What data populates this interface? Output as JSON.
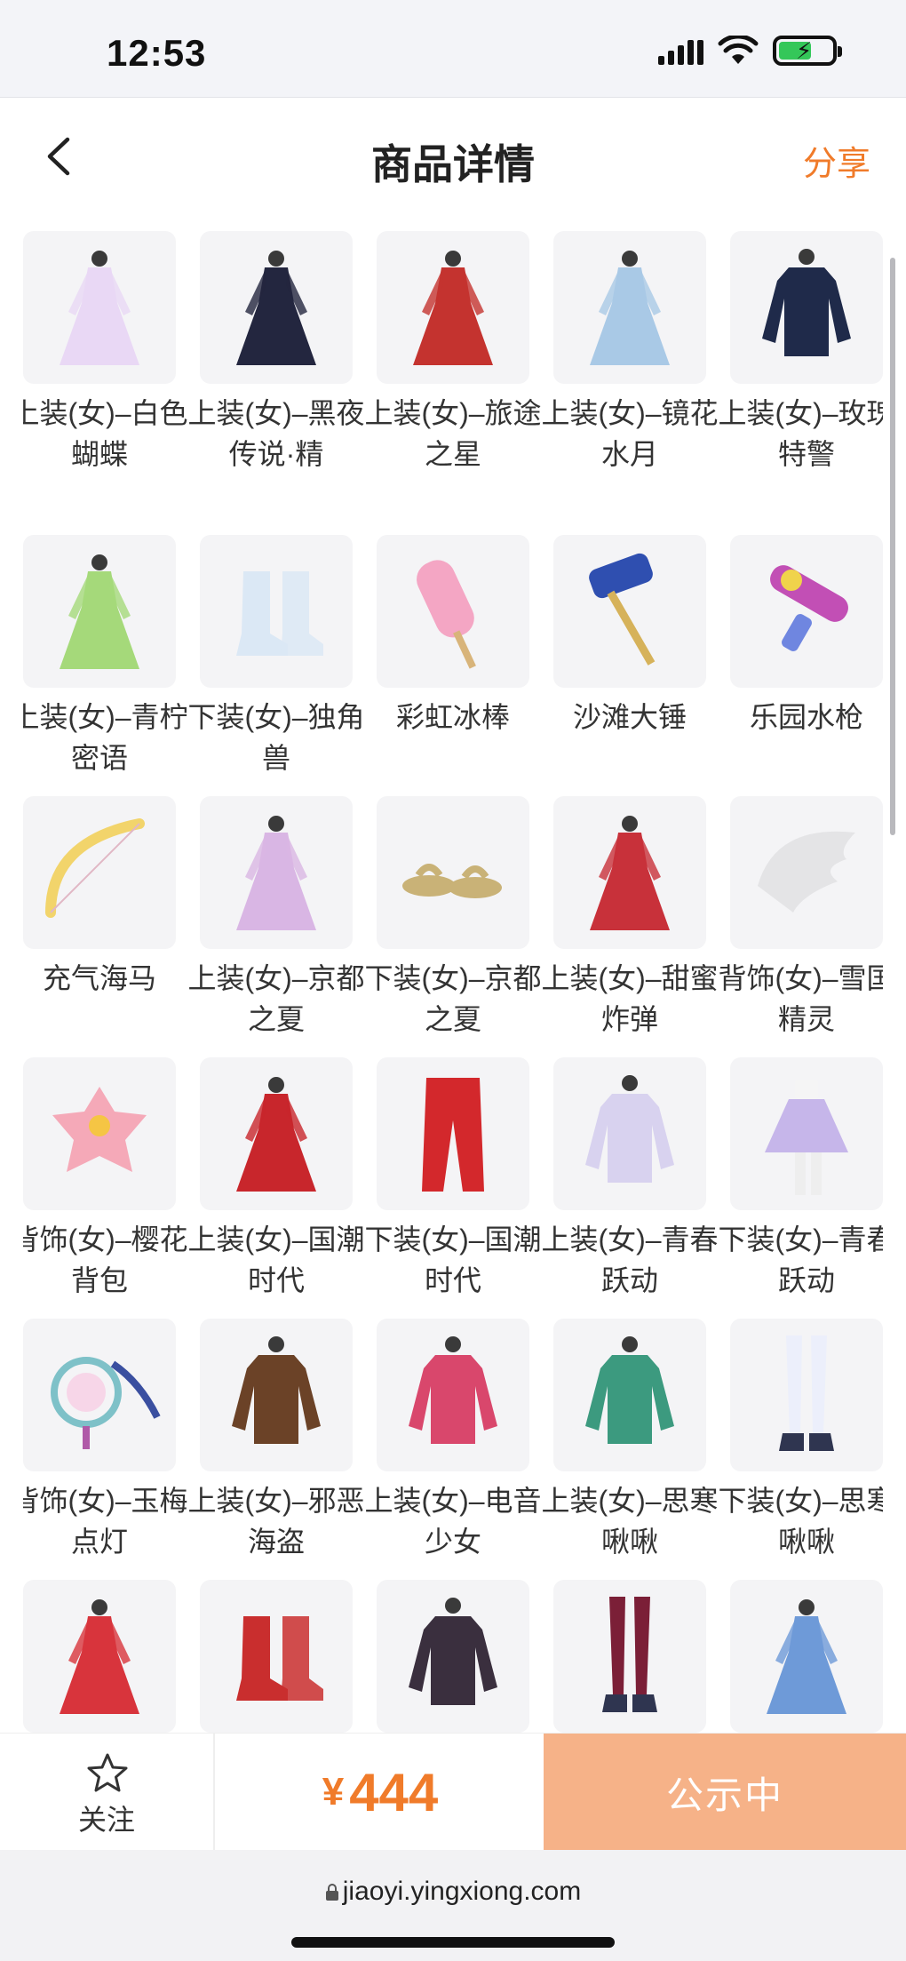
{
  "status_bar": {
    "time": "12:53"
  },
  "nav": {
    "title": "商品详情",
    "share": "分享"
  },
  "items": [
    {
      "label": "上装(女)–白色蝴蝶",
      "icon": "white-butterfly-dress-icon",
      "color": "#e9d8f5"
    },
    {
      "label": "上装(女)–黑夜传说·精",
      "icon": "black-night-legend-outfit-icon",
      "color": "#23263f"
    },
    {
      "label": "上装(女)–旅途之星",
      "icon": "journey-star-outfit-icon",
      "color": "#c4332f"
    },
    {
      "label": "上装(女)–镜花水月",
      "icon": "mirror-flower-outfit-icon",
      "color": "#a9c9e6"
    },
    {
      "label": "上装(女)–玫瑰特警",
      "icon": "rose-police-outfit-icon",
      "color": "#1f2a4a"
    },
    {
      "label": "上装(女)–青柠密语",
      "icon": "lime-whisper-dress-icon",
      "color": "#a5d97a"
    },
    {
      "label": "下装(女)–独角兽",
      "icon": "unicorn-boots-icon",
      "color": "#dbe8f5"
    },
    {
      "label": "彩虹冰棒",
      "icon": "rainbow-popsicle-icon",
      "color": "#f4a6c4"
    },
    {
      "label": "沙滩大锤",
      "icon": "beach-hammer-icon",
      "color": "#2f4fb0"
    },
    {
      "label": "乐园水枪",
      "icon": "water-gun-icon",
      "color": "#c24fb5"
    },
    {
      "label": "充气海马",
      "icon": "inflatable-seahorse-icon",
      "color": "#f2d46b"
    },
    {
      "label": "上装(女)–京都之夏",
      "icon": "kyoto-summer-kimono-icon",
      "color": "#d9b6e4"
    },
    {
      "label": "下装(女)–京都之夏",
      "icon": "kyoto-summer-sandals-icon",
      "color": "#c9b277"
    },
    {
      "label": "上装(女)–甜蜜炸弹",
      "icon": "sweet-bomb-dress-icon",
      "color": "#c8313a"
    },
    {
      "label": "背饰(女)–雪国精灵",
      "icon": "snow-wing-icon",
      "color": "#e4e4e6"
    },
    {
      "label": "背饰(女)–樱花背包",
      "icon": "sakura-backpack-icon",
      "color": "#f5a9b8"
    },
    {
      "label": "上装(女)–国潮时代",
      "icon": "chinese-trend-top-icon",
      "color": "#c8262c"
    },
    {
      "label": "下装(女)–国潮时代",
      "icon": "chinese-trend-pants-icon",
      "color": "#d3282c"
    },
    {
      "label": "上装(女)–青春跃动",
      "icon": "youth-jacket-icon",
      "color": "#d8d2ef"
    },
    {
      "label": "下装(女)–青春跃动",
      "icon": "youth-skirt-icon",
      "color": "#c6b6ea"
    },
    {
      "label": "背饰(女)–玉梅点灯",
      "icon": "plum-lantern-icon",
      "color": "#7ec1c8"
    },
    {
      "label": "上装(女)–邪恶海盗",
      "icon": "evil-pirate-outfit-icon",
      "color": "#6b4227"
    },
    {
      "label": "上装(女)–电音少女",
      "icon": "electro-girl-jacket-icon",
      "color": "#d9476c"
    },
    {
      "label": "上装(女)–思寒啾啾",
      "icon": "sihan-jacket-icon",
      "color": "#3c9a7f"
    },
    {
      "label": "下装(女)–思寒啾啾",
      "icon": "sihan-stockings-icon",
      "color": "#eceffb"
    },
    {
      "label": "",
      "icon": "red-gown-icon",
      "color": "#d8343c"
    },
    {
      "label": "",
      "icon": "red-boots-icon",
      "color": "#c92e2e"
    },
    {
      "label": "",
      "icon": "dark-jacket-icon",
      "color": "#3a2f3e"
    },
    {
      "label": "",
      "icon": "leg-boots-icon",
      "color": "#7b1f37"
    },
    {
      "label": "",
      "icon": "blue-robe-icon",
      "color": "#6e9ad8"
    }
  ],
  "action_bar": {
    "follow": "关注",
    "price_symbol": "¥",
    "price": "444",
    "status": "公示中"
  },
  "browser": {
    "url": "jiaoyi.yingxiong.com"
  }
}
